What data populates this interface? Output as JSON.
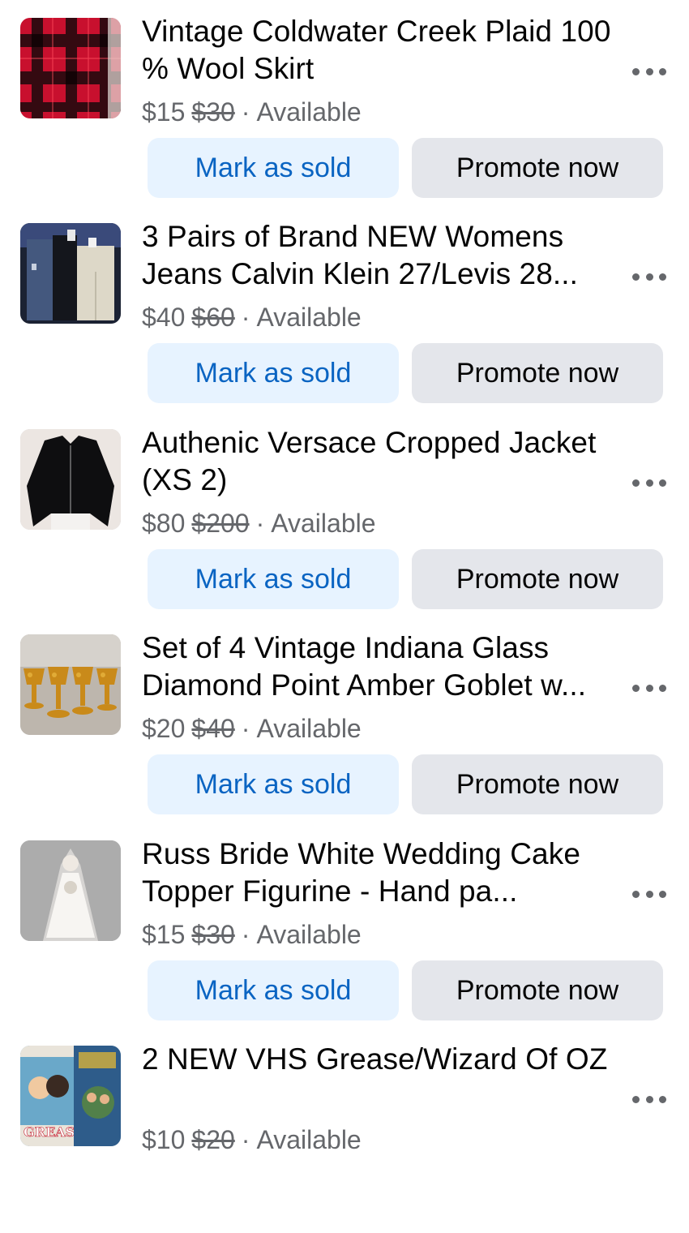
{
  "listings": [
    {
      "title": "Vintage Coldwater Creek Plaid 100 % Wool Skirt",
      "price": "$15",
      "original_price": "$30",
      "status": "Available",
      "thumb": "plaid-skirt"
    },
    {
      "title": "3 Pairs of Brand NEW Womens Jeans Calvin Klein 27/Levis 28...",
      "price": "$40",
      "original_price": "$60",
      "status": "Available",
      "thumb": "jeans"
    },
    {
      "title": "Authenic Versace Cropped Jacket (XS 2)",
      "price": "$80",
      "original_price": "$200",
      "status": "Available",
      "thumb": "black-jacket"
    },
    {
      "title": "Set of 4 Vintage Indiana Glass Diamond Point Amber Goblet w...",
      "price": "$20",
      "original_price": "$40",
      "status": "Available",
      "thumb": "amber-goblets"
    },
    {
      "title": "Russ Bride White Wedding Cake Topper Figurine - Hand pa...",
      "price": "$15",
      "original_price": "$30",
      "status": "Available",
      "thumb": "bride-figurine"
    },
    {
      "title": "2 NEW VHS Grease/Wizard Of OZ",
      "price": "$10",
      "original_price": "$20",
      "status": "Available",
      "thumb": "vhs-tapes"
    }
  ],
  "actions": {
    "mark_sold_label": "Mark as sold",
    "promote_label": "Promote now",
    "separator": "·"
  },
  "icons": {
    "more": "more-horizontal-icon"
  },
  "colors": {
    "mark_sold_bg": "#e7f3ff",
    "mark_sold_text": "#0a64c2",
    "promote_bg": "#e4e6eb",
    "secondary_text": "#65676b"
  },
  "thumb_texts": {
    "grease": "GREASE"
  }
}
